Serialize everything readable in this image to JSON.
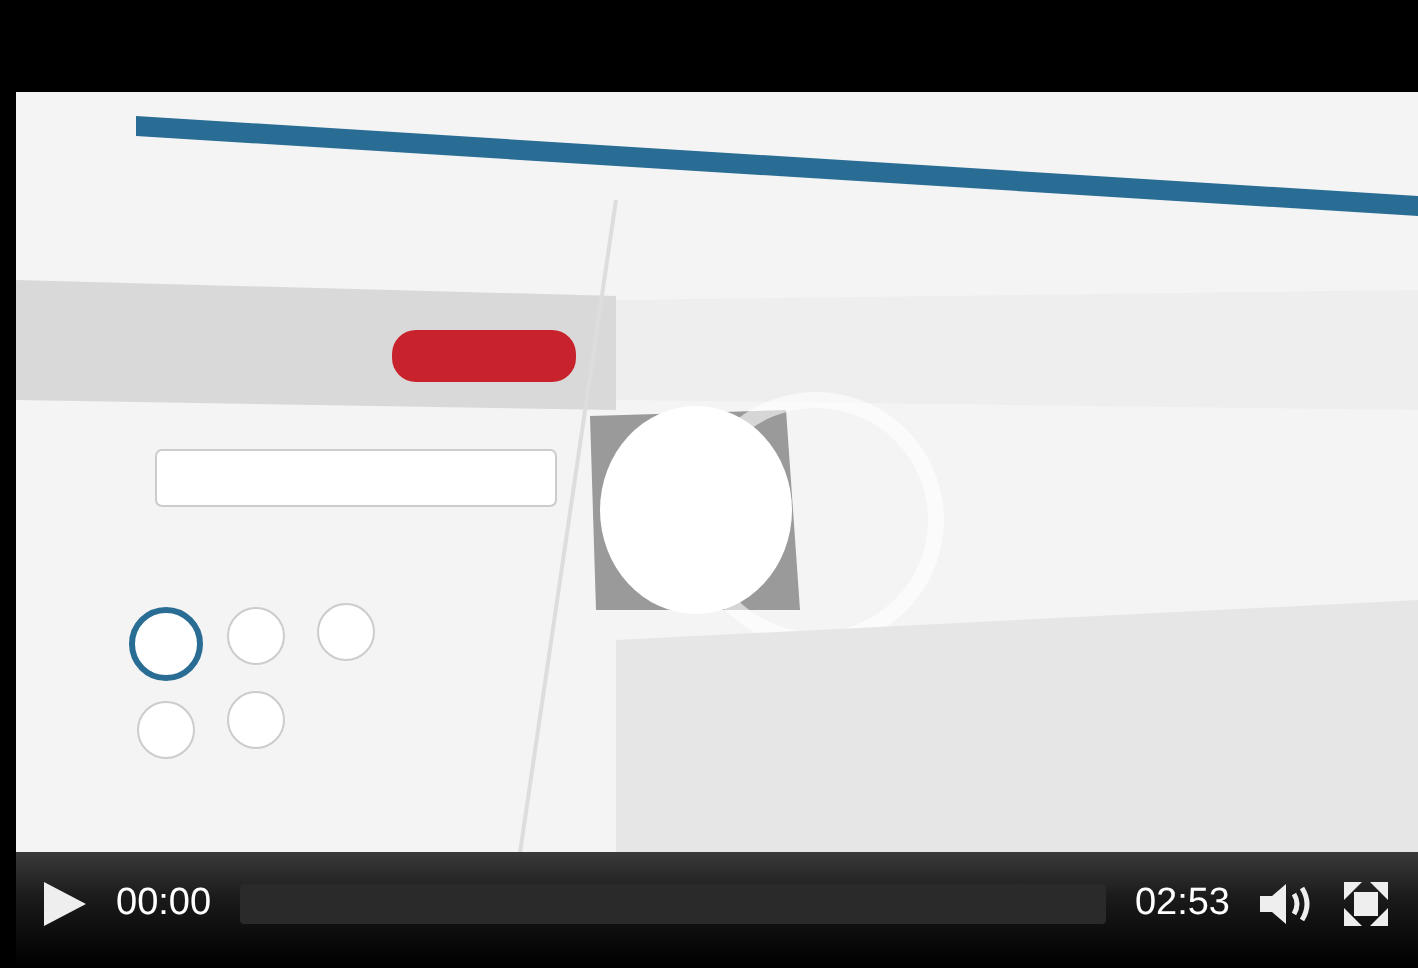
{
  "player": {
    "current_time": "00:00",
    "progress": {
      "level": 0
    },
    "duration": "02:53"
  }
}
